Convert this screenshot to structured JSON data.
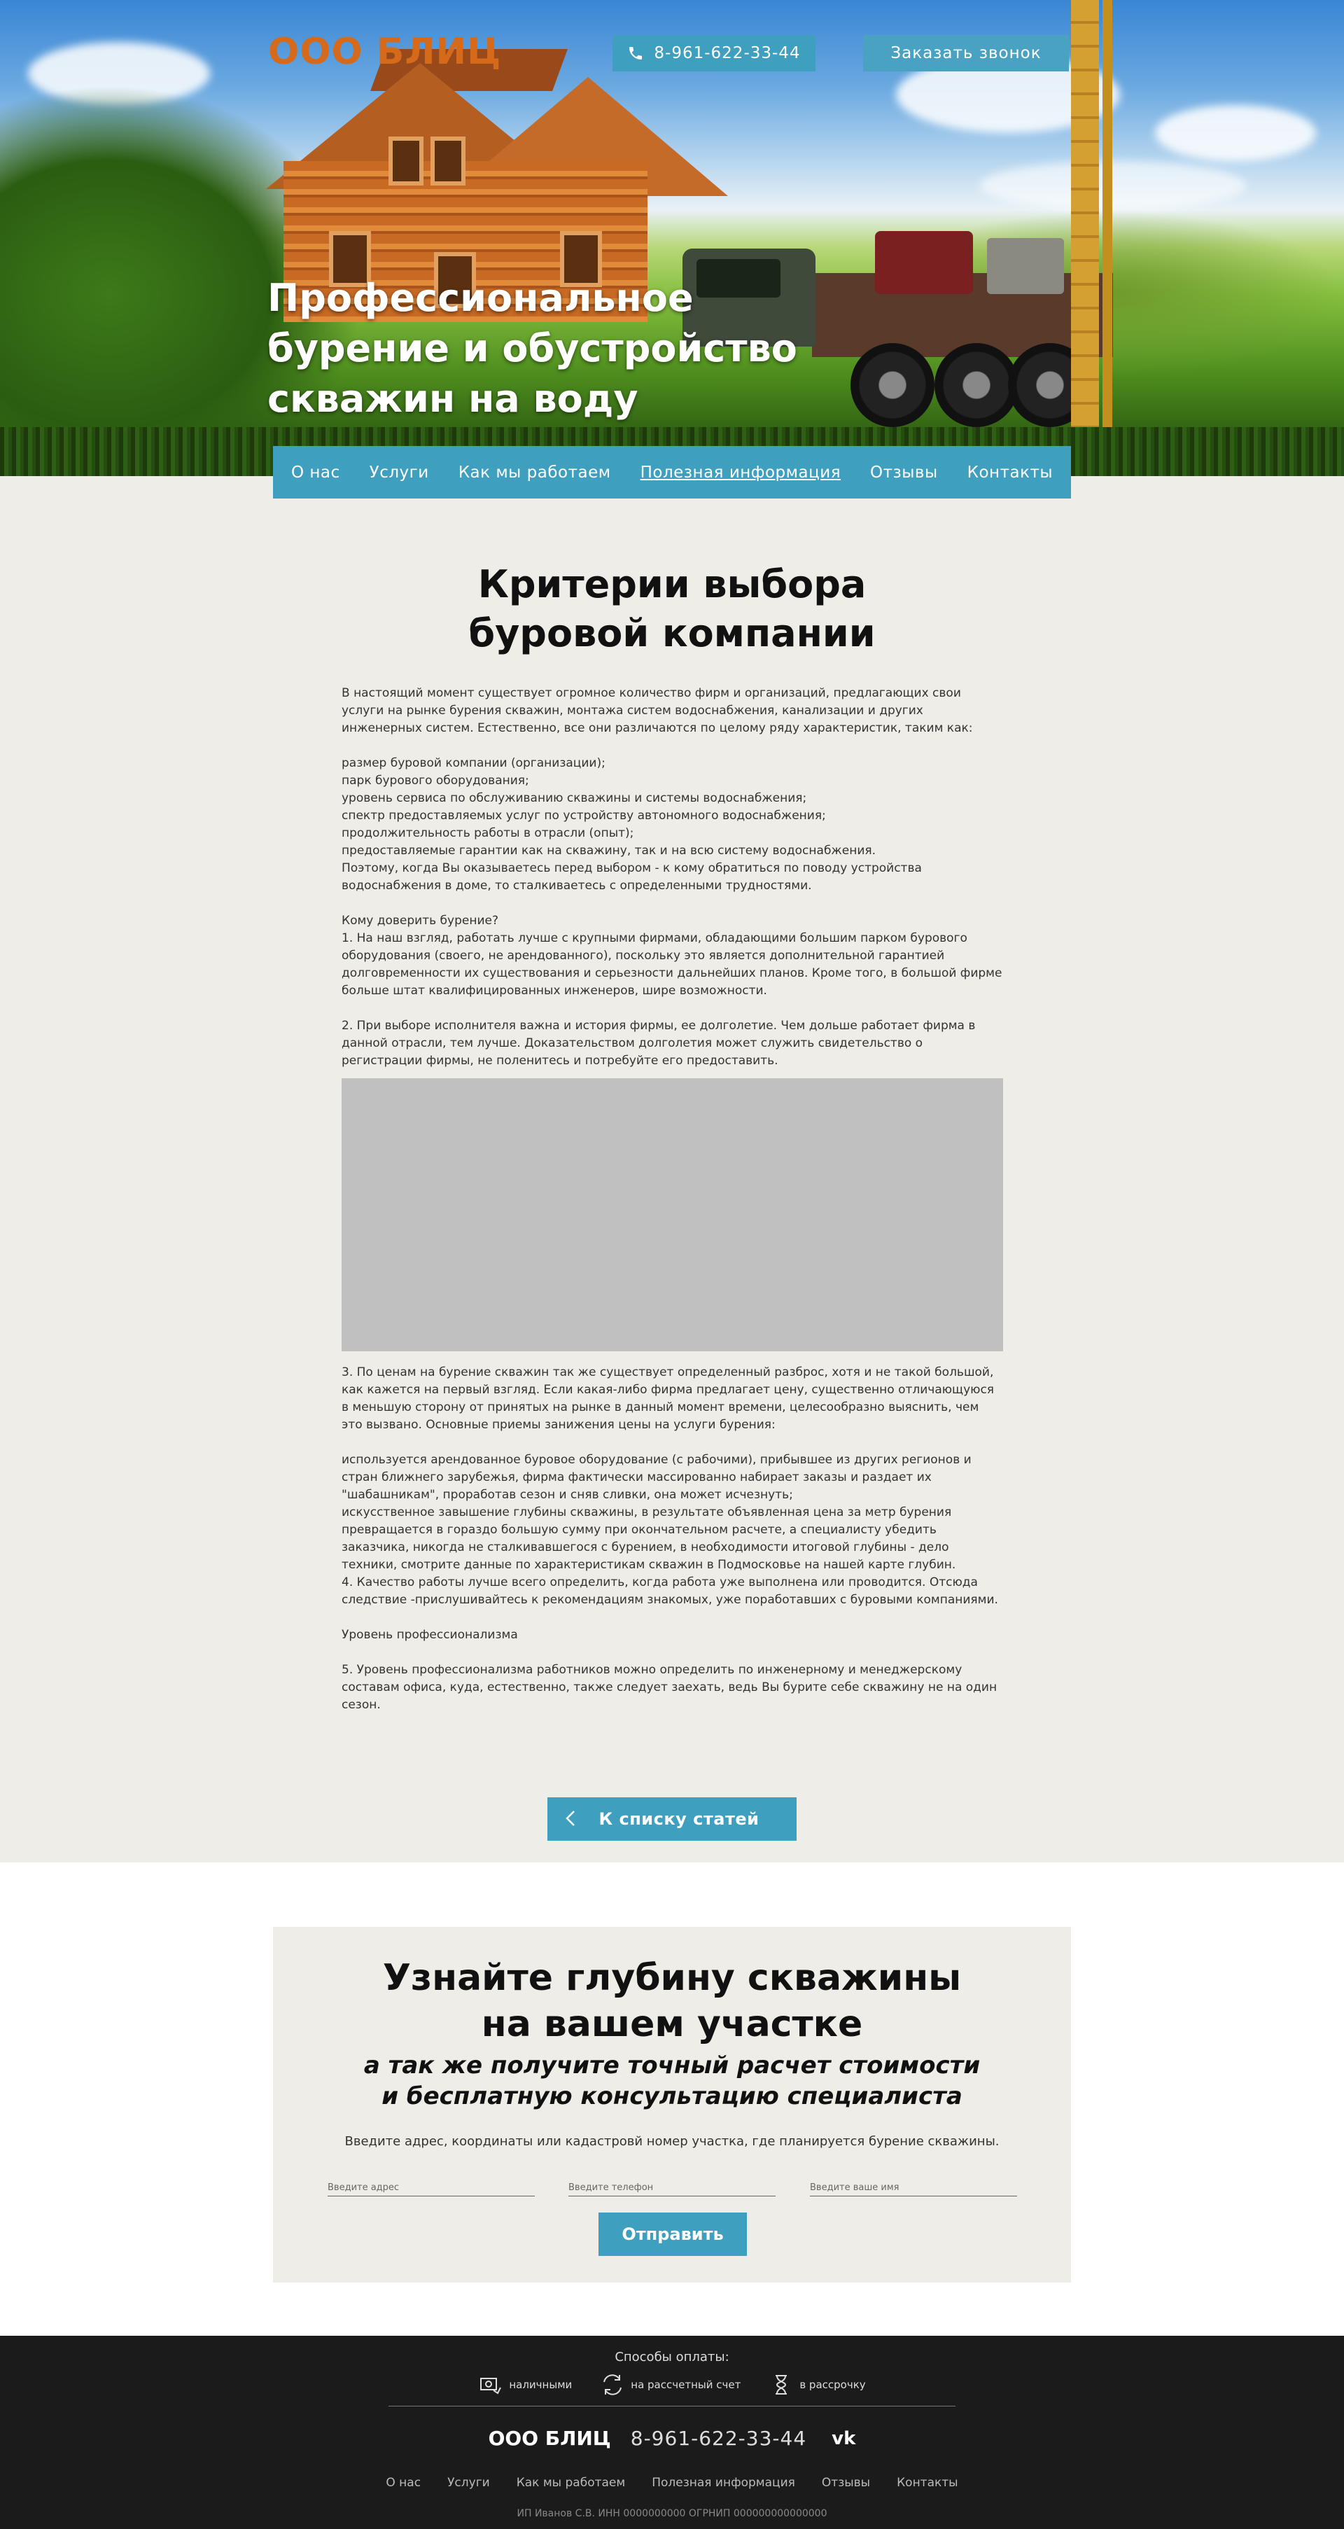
{
  "header": {
    "logo": "ООО БЛИЦ",
    "phone": "8-961-622-33-44",
    "call_button": "Заказать звонок"
  },
  "hero": {
    "title": "Профессиональное\nбурение и обустройство\nскважин на воду"
  },
  "nav": {
    "items": [
      {
        "label": "О нас"
      },
      {
        "label": "Услуги"
      },
      {
        "label": "Как мы работаем"
      },
      {
        "label": "Полезная информация"
      },
      {
        "label": "Отзывы"
      },
      {
        "label": "Контакты"
      }
    ]
  },
  "article": {
    "title": "Критерии выбора\nбуровой компании",
    "body_part1": "В настоящий момент существует огромное количество фирм и организаций, предлагающих свои услуги на рынке бурения скважин, монтажа систем водоснабжения, канализации и других инженерных систем. Естественно, все они различаются по целому ряду характеристик, таким как:\n\nразмер буровой компании (организации);\nпарк бурового оборудования;\nуровень сервиса по обслуживанию скважины и системы водоснабжения;\nспектр предоставляемых услуг по устройству автономного водоснабжения;\nпродолжительность работы в отрасли (опыт);\nпредоставляемые гарантии как на скважину, так и на всю систему водоснабжения.\nПоэтому, когда Вы оказываетесь перед выбором - к кому обратиться по поводу устройства водоснабжения в доме, то сталкиваетесь с определенными трудностями.\n\nКому доверить бурение?\n1. На наш взгляд, работать лучше с крупными фирмами, обладающими большим парком бурового оборудования (своего, не арендованного), поскольку это является дополнительной гарантией долговременности их существования и серьезности дальнейших планов. Кроме того, в большой фирме больше штат квалифицированных инженеров, шире возможности.\n\n2. При выборе исполнителя важна и история фирмы, ее долголетие. Чем дольше работает фирма в данной отрасли, тем лучше. Доказательством долголетия может служить свидетельство о регистрации фирмы, не поленитесь и потребуйте его предоставить.",
    "body_part2": "3. По ценам на бурение скважин так же существует определенный разброс, хотя и не такой большой, как кажется на первый взгляд. Если какая-либо фирма предлагает цену, существенно отличающуюся в меньшую сторону от принятых на рынке в данный момент времени, целесообразно выяснить, чем это вызвано. Основные приемы занижения цены на услуги бурения:\n\nиспользуется арендованное буровое оборудование (с рабочими), прибывшее из других регионов и стран ближнего зарубежья, фирма фактически массированно набирает заказы и раздает их \"шабашникам\", проработав сезон и сняв сливки, она может исчезнуть;\nискусственное завышение глубины скважины, в результате объявленная цена за метр бурения превращается в гораздо большую сумму при окончательном расчете, а специалисту убедить заказчика, никогда не сталкивавшегося с бурением, в необходимости итоговой глубины - дело техники, смотрите данные по характеристикам скважин в Подмосковье на нашей карте глубин.\n4. Качество работы лучше всего определить, когда работа уже выполнена или проводится. Отсюда следствие -прислушивайтесь к рекомендациям знакомых, уже поработавших с буровыми компаниями.\n\nУровень профессионализма\n\n5. Уровень профессионализма работников можно определить по инженерному и менеджерскому составам офиса, куда, естественно, также следует заехать, ведь Вы бурите себе скважину не на один сезон.",
    "back_button": "К списку статей"
  },
  "form": {
    "title": "Узнайте глубину скважины\nна вашем участке",
    "subtitle": "а так же получите точный расчет стоимости\nи бесплатную консультацию специалиста",
    "hint": "Введите адрес, координаты или кадастровй номер участка, где планируется бурение скважины.",
    "address_placeholder": "Введите адрес",
    "phone_placeholder": "Введите телефон",
    "name_placeholder": "Введите ваше имя",
    "submit": "Отправить"
  },
  "footer": {
    "payment_title": "Способы оплаты:",
    "payment_methods": [
      {
        "label": "наличными",
        "icon": "cash-icon"
      },
      {
        "label": "на рассчетный счет",
        "icon": "transfer-icon"
      },
      {
        "label": "в рассрочку",
        "icon": "hourglass-icon"
      }
    ],
    "logo": "ООО БЛИЦ",
    "phone": "8-961-622-33-44",
    "social": "vk",
    "nav": [
      "О нас",
      "Услуги",
      "Как мы работаем",
      "Полезная информация",
      "Отзывы",
      "Контакты"
    ],
    "legal": "ИП Иванов С.В. ИНН 0000000000 ОГРНИП 000000000000000"
  },
  "colors": {
    "accent": "#3e9fbf",
    "logo": "#d46a1a",
    "section_bg": "#eeede7",
    "footer_bg": "#1b1b1b"
  }
}
